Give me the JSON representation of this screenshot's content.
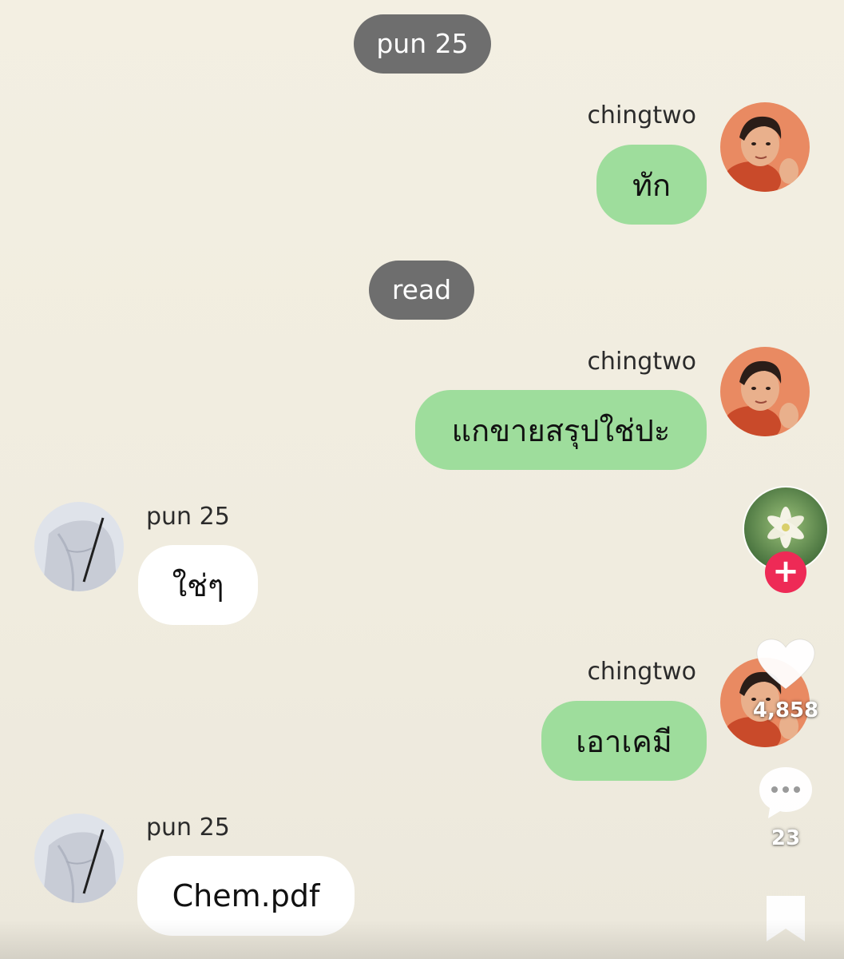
{
  "chat": {
    "header_pill": "pun 25",
    "read_pill": "read",
    "messages": [
      {
        "sender": "chingtwo",
        "text": "ทัก"
      },
      {
        "sender": "chingtwo",
        "text": "แกขายสรุปใช่ปะ"
      },
      {
        "sender": "pun 25",
        "text": "ใช่ๆ"
      },
      {
        "sender": "chingtwo",
        "text": "เอาเคมี"
      },
      {
        "sender": "pun 25",
        "text": "Chem.pdf"
      }
    ]
  },
  "actions": {
    "follow_symbol": "+",
    "likes": "4,858",
    "comments": "23"
  },
  "colors": {
    "background": "#f2eee1",
    "outgoing_bubble": "#9edd9c",
    "incoming_bubble": "#ffffff",
    "pill": "#6e6e6e",
    "follow_button": "#ee2a56"
  },
  "icons": [
    "heart-icon",
    "comment-icon",
    "bookmark-icon",
    "plus-icon"
  ]
}
